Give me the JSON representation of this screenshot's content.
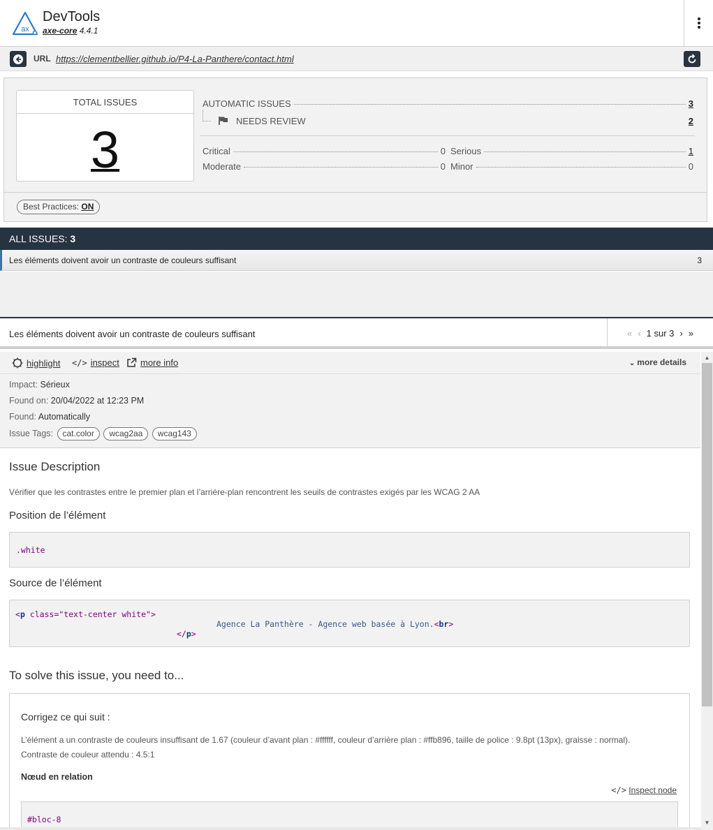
{
  "header": {
    "title": "DevTools",
    "engine": "axe-core",
    "version": "4.4.1",
    "logo_text": "ax"
  },
  "urlbar": {
    "label": "URL",
    "url": "https://clementbellier.github.io/P4-La-Panthere/contact.html"
  },
  "summary": {
    "total_label": "TOTAL ISSUES",
    "total_value": "3",
    "automatic_label": "AUTOMATIC ISSUES",
    "automatic_value": "3",
    "needs_review_label": "NEEDS REVIEW",
    "needs_review_value": "2",
    "critical_label": "Critical",
    "critical_value": "0",
    "serious_label": "Serious",
    "serious_value": "1",
    "moderate_label": "Moderate",
    "moderate_value": "0",
    "minor_label": "Minor",
    "minor_value": "0",
    "best_practices_label": "Best Practices:",
    "best_practices_value": "ON"
  },
  "all_issues": {
    "label": "ALL ISSUES:",
    "count": "3",
    "items": [
      {
        "title": "Les éléments doivent avoir un contraste de couleurs suffisant",
        "count": "3"
      }
    ]
  },
  "detail": {
    "title": "Les éléments doivent avoir un contraste de couleurs suffisant",
    "pager": "1 sur 3",
    "actions": {
      "highlight": "highlight",
      "inspect": "inspect",
      "more_info": "more info",
      "more_details": "more details"
    },
    "impact_label": "Impact:",
    "impact_value": "Sérieux",
    "found_on_label": "Found on:",
    "found_on_value": "20/04/2022 at 12:23 PM",
    "found_label": "Found:",
    "found_value": "Automatically",
    "tags_label": "Issue Tags:",
    "tags": [
      "cat.color",
      "wcag2aa",
      "wcag143"
    ],
    "description_heading": "Issue Description",
    "description": "Vérifier que les contrastes entre le premier plan et l’arrière-plan rencontrent les seuils de contrastes exigés par les WCAG 2 AA",
    "position_heading": "Position de l’élément",
    "position_selector": ".white",
    "source_heading": "Source de l’élément",
    "source_line1_tag": "p",
    "source_line1_attr": "class",
    "source_line1_value": "\"text-center white\"",
    "source_text": "Agence La Panthère - Agence web basée à Lyon.",
    "source_br": "br",
    "source_close": "p",
    "solve_heading": "To solve this issue, you need to...",
    "fix_heading": "Corrigez ce qui suit :",
    "fix_text": "L’élément a un contraste de couleurs insuffisant de 1.67 (couleur d’avant plan : #ffffff, couleur d’arrière plan : #ffb896, taille de police : 9.8pt (13px), graisse : normal). Contraste de couleur attendu : 4.5:1",
    "related_node_label": "Nœud en relation",
    "inspect_node": "Inspect node",
    "node_selector": "#bloc-8"
  },
  "colors": {
    "dark_bar": "#263340",
    "accent": "#3d72a8",
    "code_purple": "#800080"
  }
}
